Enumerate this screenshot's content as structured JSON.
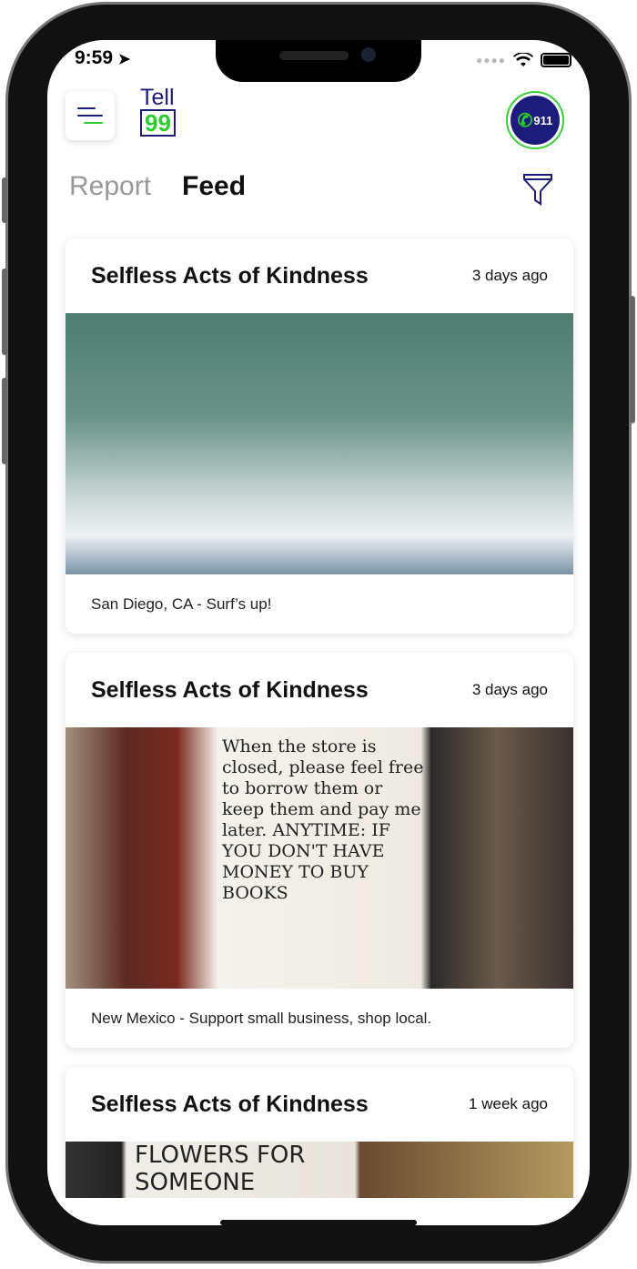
{
  "status_bar": {
    "time": "9:59",
    "icons": [
      "location-arrow-icon",
      "signal-dots-icon",
      "wifi-icon",
      "battery-icon"
    ]
  },
  "header": {
    "logo_top": "Tell",
    "logo_bottom": "99",
    "emergency_label": "911"
  },
  "tabs": [
    {
      "label": "Report",
      "active": false
    },
    {
      "label": "Feed",
      "active": true
    }
  ],
  "colors": {
    "brand_navy": "#1c1c7a",
    "brand_green": "#2ecc2e"
  },
  "feed": [
    {
      "title": "Selfless Acts of Kindness",
      "ago": "3 days ago",
      "caption": "San Diego, CA - Surf’s up!"
    },
    {
      "title": "Selfless Acts of Kindness",
      "ago": "3 days ago",
      "caption": "New Mexico - Support small business, shop local.",
      "image_text": "When the store is closed, please feel free to borrow them or keep them and pay me later. ANYTIME: IF YOU DON'T HAVE MONEY TO BUY BOOKS"
    },
    {
      "title": "Selfless Acts of Kindness",
      "ago": "1 week ago",
      "image_text": "FLOWERS FOR SOMEONE"
    }
  ]
}
